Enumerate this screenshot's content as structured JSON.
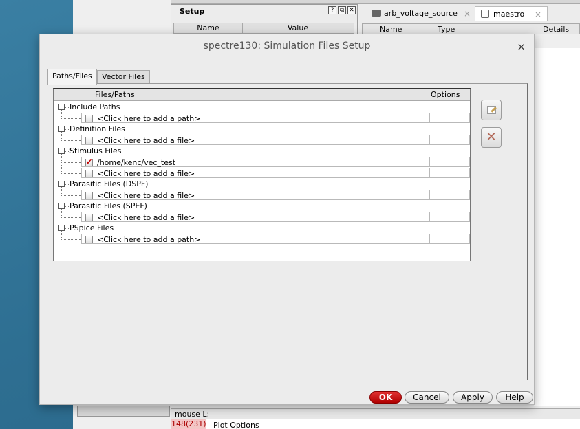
{
  "background": {
    "setup_panel": {
      "title": "Setup",
      "col_name": "Name",
      "col_value": "Value",
      "btns": [
        "?",
        "⧉",
        "✕"
      ]
    },
    "tabs": [
      {
        "label": "arb_voltage_source",
        "close": "×"
      },
      {
        "label": "maestro",
        "close": "×"
      }
    ],
    "results_header": {
      "name": "Name",
      "type": "Type",
      "details": "Details"
    },
    "status": "mouse L:",
    "counter": "148(231)",
    "plot_options": "Plot Options"
  },
  "dialog": {
    "title": "spectre130: Simulation Files Setup",
    "close": "×",
    "tabs": [
      "Paths/Files",
      "Vector Files"
    ],
    "columns": {
      "files": "Files/Paths",
      "options": "Options"
    },
    "groups": [
      {
        "label": "Include Paths",
        "items": [
          {
            "text": "<Click here to add a path>",
            "checked": false
          }
        ]
      },
      {
        "label": "Definition Files",
        "items": [
          {
            "text": "<Click here to add a file>",
            "checked": false
          }
        ]
      },
      {
        "label": "Stimulus Files",
        "items": [
          {
            "text": "/home/kenc/vec_test",
            "checked": true
          },
          {
            "text": "<Click here to add a file>",
            "checked": false
          }
        ]
      },
      {
        "label": "Parasitic Files (DSPF)",
        "items": [
          {
            "text": "<Click here to add a file>",
            "checked": false
          }
        ]
      },
      {
        "label": "Parasitic Files (SPEF)",
        "items": [
          {
            "text": "<Click here to add a file>",
            "checked": false
          }
        ]
      },
      {
        "label": "PSpice Files",
        "items": [
          {
            "text": "<Click here to add a path>",
            "checked": false
          }
        ]
      }
    ],
    "buttons": {
      "ok": "OK",
      "cancel": "Cancel",
      "apply": "Apply",
      "help": "Help"
    }
  }
}
